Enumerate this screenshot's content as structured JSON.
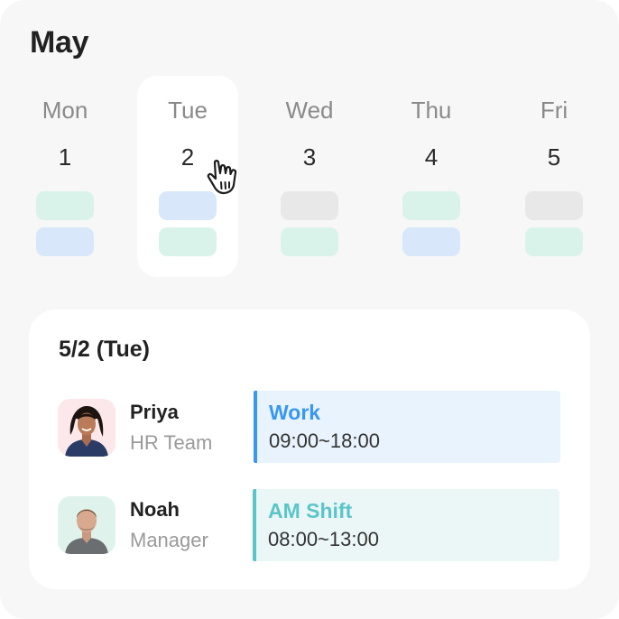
{
  "calendar": {
    "month": "May",
    "selected_index": 1,
    "days": [
      {
        "name": "Mon",
        "number": "1",
        "chips": [
          "green",
          "blue"
        ]
      },
      {
        "name": "Tue",
        "number": "2",
        "chips": [
          "blue",
          "green"
        ]
      },
      {
        "name": "Wed",
        "number": "3",
        "chips": [
          "gray",
          "green"
        ]
      },
      {
        "name": "Thu",
        "number": "4",
        "chips": [
          "green",
          "blue"
        ]
      },
      {
        "name": "Fri",
        "number": "5",
        "chips": [
          "gray",
          "green"
        ]
      }
    ]
  },
  "detail": {
    "date_label": "5/2 (Tue)",
    "entries": [
      {
        "name": "Priya",
        "team": "HR Team",
        "shift_type": "Work",
        "shift_time": "09:00~18:00",
        "accent": "#3a97f0",
        "shift_bg": "#e8f3fd",
        "avatar_bg": "#fce8ea"
      },
      {
        "name": "Noah",
        "team": "Manager",
        "shift_type": "AM Shift",
        "shift_time": "08:00~13:00",
        "accent": "#5cc5c8",
        "shift_bg": "#ebf7f7",
        "avatar_bg": "#dff3ec"
      }
    ]
  },
  "colors": {
    "chip_green": "#daf3ea",
    "chip_blue": "#d8e8fa",
    "chip_gray": "#e8e8e8",
    "background": "#f7f7f7"
  },
  "icons": {
    "cursor": "hand-pointer-icon"
  }
}
